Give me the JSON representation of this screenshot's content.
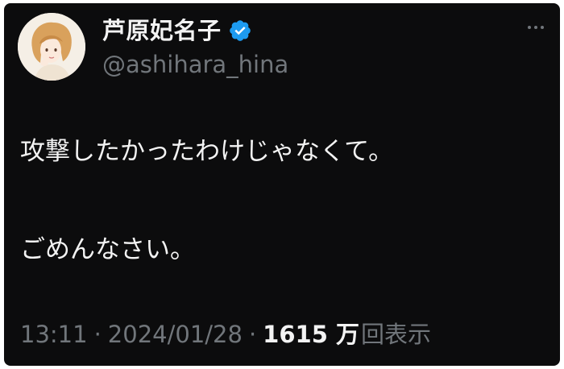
{
  "author": {
    "display_name": "芦原妃名子",
    "handle": "@ashihara_hina",
    "verified": true,
    "verified_color": "#1d9bf0"
  },
  "avatar": {
    "icon": "avatar-illustration"
  },
  "more_menu": {
    "icon": "more-dots-icon"
  },
  "tweet": {
    "line1": "攻撃したかったわけじゃなくて。",
    "line2": "ごめんなさい。"
  },
  "meta": {
    "time": "13:11",
    "separator": "·",
    "date": "2024/01/28",
    "views_count": "1615 万",
    "views_label": "回表示"
  },
  "colors": {
    "background": "#0c0c0d",
    "text_primary": "#f3f3f3",
    "text_secondary": "#71767b"
  }
}
